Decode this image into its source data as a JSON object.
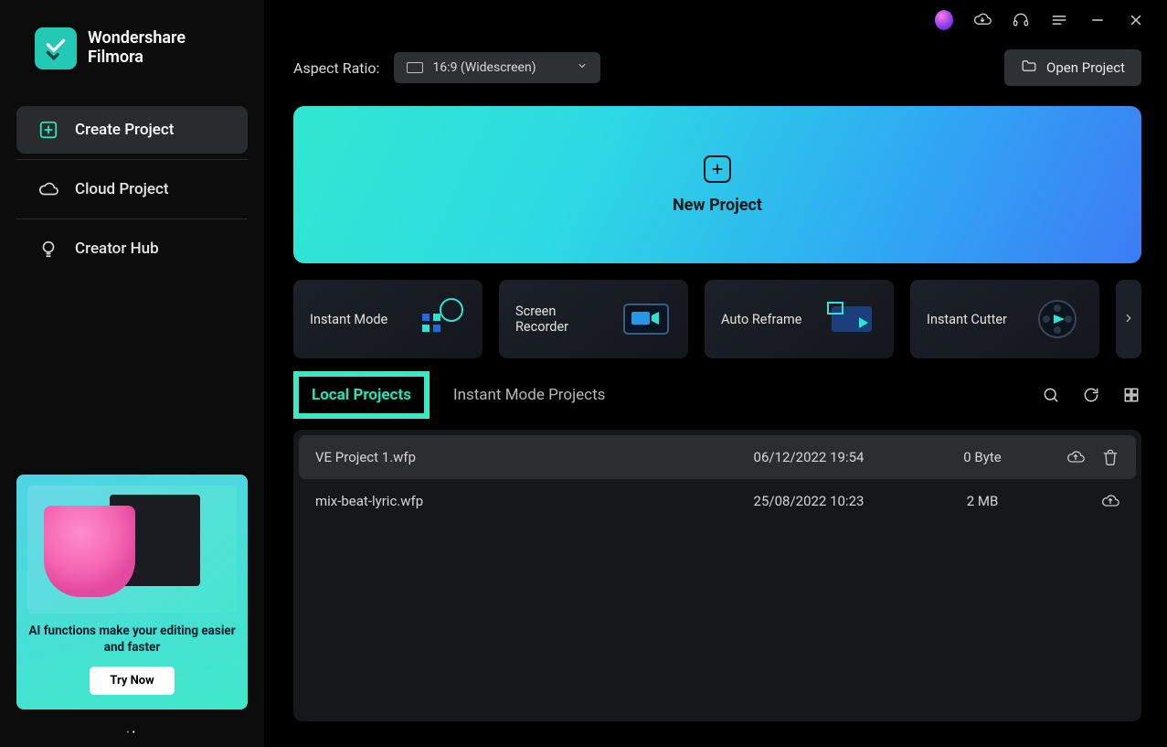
{
  "brand": {
    "line1": "Wondershare",
    "line2": "Filmora"
  },
  "sidebar": {
    "items": [
      {
        "label": "Create Project"
      },
      {
        "label": "Cloud Project"
      },
      {
        "label": "Creator Hub"
      }
    ]
  },
  "promo": {
    "text": "AI functions make your editing easier and faster",
    "button": "Try Now"
  },
  "aspect_ratio": {
    "label": "Aspect Ratio:",
    "value": "16:9 (Widescreen)"
  },
  "open_project": "Open Project",
  "new_project": "New Project",
  "modes": [
    {
      "label": "Instant Mode"
    },
    {
      "label": "Screen Recorder"
    },
    {
      "label": "Auto Reframe"
    },
    {
      "label": "Instant Cutter"
    }
  ],
  "tabs": {
    "local": "Local Projects",
    "instant": "Instant Mode Projects"
  },
  "projects": [
    {
      "name": "VE Project 1.wfp",
      "date": "06/12/2022 19:54",
      "size": "0 Byte"
    },
    {
      "name": "mix-beat-lyric.wfp",
      "date": "25/08/2022 10:23",
      "size": "2 MB"
    }
  ]
}
